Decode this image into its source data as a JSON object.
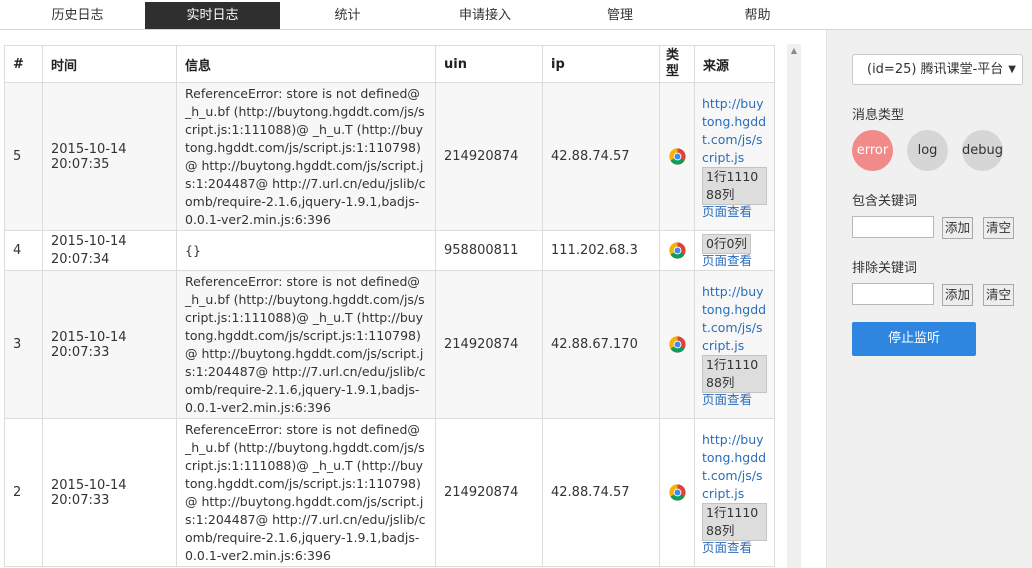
{
  "nav": {
    "items": [
      {
        "label": "历史日志",
        "active": false
      },
      {
        "label": "实时日志",
        "active": true
      },
      {
        "label": "统计",
        "active": false
      },
      {
        "label": "申请接入",
        "active": false
      },
      {
        "label": "管理",
        "active": false
      },
      {
        "label": "帮助",
        "active": false
      }
    ]
  },
  "table": {
    "headers": {
      "num": "#",
      "time": "时间",
      "info": "信息",
      "uin": "uin",
      "ip": "ip",
      "type": "类型",
      "source": "来源"
    },
    "rows": [
      {
        "num": "5",
        "date": "2015-10-14",
        "clock": "20:07:35",
        "info": "ReferenceError: store is not defined@ _h_u.bf (http://buytong.hgddt.com/js/script.js:1:111088)@ _h_u.T (http://buytong.hgddt.com/js/script.js:1:110798)@ http://buytong.hgddt.com/js/script.js:1:204487@ http://7.url.cn/edu/jslib/comb/require-2.1.6,jquery-1.9.1,badjs-0.0.1-ver2.min.js:6:396",
        "uin": "214920874",
        "ip": "42.88.74.57",
        "browser_icon": "chrome-icon",
        "source_url": "http://buytong.hgddt.com/js/script.js",
        "position": "1行111088列",
        "view_label": "页面查看"
      },
      {
        "num": "4",
        "date": "2015-10-14",
        "clock": "20:07:34",
        "info": "{}",
        "uin": "958800811",
        "ip": "111.202.68.3",
        "browser_icon": "chrome-icon",
        "source_url": "",
        "position": "0行0列",
        "view_label": "页面查看"
      },
      {
        "num": "3",
        "date": "2015-10-14",
        "clock": "20:07:33",
        "info": "ReferenceError: store is not defined@ _h_u.bf (http://buytong.hgddt.com/js/script.js:1:111088)@ _h_u.T (http://buytong.hgddt.com/js/script.js:1:110798)@ http://buytong.hgddt.com/js/script.js:1:204487@ http://7.url.cn/edu/jslib/comb/require-2.1.6,jquery-1.9.1,badjs-0.0.1-ver2.min.js:6:396",
        "uin": "214920874",
        "ip": "42.88.67.170",
        "browser_icon": "chrome-icon",
        "source_url": "http://buytong.hgddt.com/js/script.js",
        "position": "1行111088列",
        "view_label": "页面查看"
      },
      {
        "num": "2",
        "date": "2015-10-14",
        "clock": "20:07:33",
        "info": "ReferenceError: store is not defined@ _h_u.bf (http://buytong.hgddt.com/js/script.js:1:111088)@ _h_u.T (http://buytong.hgddt.com/js/script.js:1:110798)@ http://buytong.hgddt.com/js/script.js:1:204487@ http://7.url.cn/edu/jslib/comb/require-2.1.6,jquery-1.9.1,badjs-0.0.1-ver2.min.js:6:396",
        "uin": "214920874",
        "ip": "42.88.74.57",
        "browser_icon": "chrome-icon",
        "source_url": "http://buytong.hgddt.com/js/script.js",
        "position": "1行111088列",
        "view_label": "页面查看"
      }
    ]
  },
  "sidebar": {
    "project_select": "(id=25) 腾讯课堂-平台",
    "message_type_label": "消息类型",
    "types": [
      {
        "label": "error",
        "active": true
      },
      {
        "label": "log",
        "active": false
      },
      {
        "label": "debug",
        "active": false
      }
    ],
    "include_label": "包含关键词",
    "include_value": "",
    "exclude_label": "排除关键词",
    "exclude_value": "",
    "add_label": "添加",
    "clear_label": "清空",
    "stop_label": "停止监听"
  },
  "colors": {
    "nav_active_bg": "#2f2f2f",
    "error_on": "#f08b89",
    "type_off": "#d6d6d6",
    "primary": "#2f86e0",
    "link": "#2a6ebb"
  }
}
